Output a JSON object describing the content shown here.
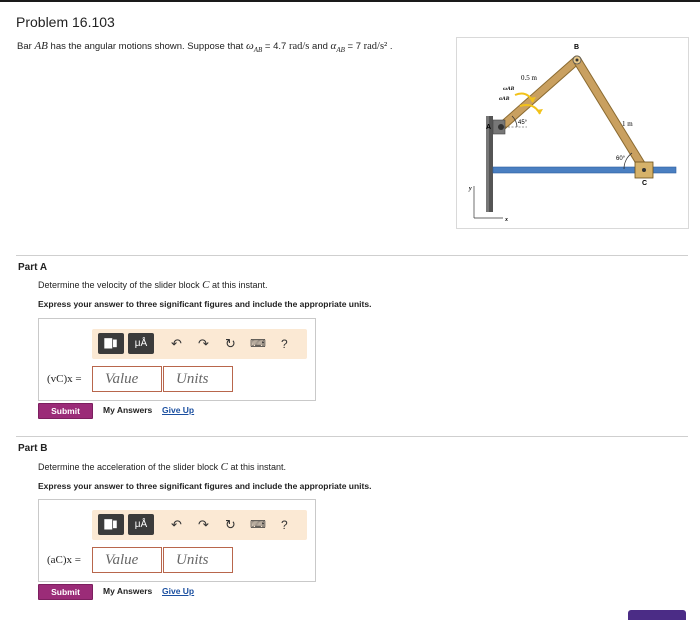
{
  "problem": {
    "title": "Problem 16.103",
    "statement_prefix": "Bar",
    "statement_bar": "AB",
    "statement_mid": "has the angular motions shown. Suppose that",
    "omega_sym": "ω",
    "omega_sub": "AB",
    "omega_eq": " = 4.7 ",
    "omega_unit": "rad/s",
    "and_text": " and ",
    "alpha_sym": "α",
    "alpha_sub": "AB",
    "alpha_eq": " = 7 ",
    "alpha_unit": "rad/s²",
    "period": " ."
  },
  "figure": {
    "label_B": "B",
    "label_A": "A",
    "label_C": "C",
    "label_len_ab": "0.5 m",
    "label_len_bc": "1 m",
    "label_omega": "ωAB",
    "label_alpha": "αAB",
    "label_angle_a": "45°",
    "label_angle_c": "60°",
    "label_axis_y": "y",
    "label_axis_x": "x"
  },
  "parts": [
    {
      "title": "Part A",
      "question_prefix": "Determine the velocity of the slider block",
      "question_var": "C",
      "question_suffix": "at this instant.",
      "instruction": "Express your answer to three significant figures and include the appropriate units.",
      "lhs_label": "(vC)x =",
      "value_placeholder": "Value",
      "units_placeholder": "Units",
      "submit_label": "Submit",
      "my_answers_label": "My Answers",
      "give_up_label": "Give Up"
    },
    {
      "title": "Part B",
      "question_prefix": "Determine the acceleration of the slider block",
      "question_var": "C",
      "question_suffix": "at this instant.",
      "instruction": "Express your answer to three significant figures and include the appropriate units.",
      "lhs_label": "(aC)x =",
      "value_placeholder": "Value",
      "units_placeholder": "Units",
      "submit_label": "Submit",
      "my_answers_label": "My Answers",
      "give_up_label": "Give Up"
    }
  ],
  "toolbar": {
    "templates_icon": "templates-icon",
    "units_label": "μÅ",
    "undo_icon": "undo-icon",
    "redo_icon": "redo-icon",
    "reset_icon": "reset-icon",
    "keyboard_icon": "keyboard-icon",
    "help_label": "?"
  },
  "colors": {
    "submit_bg": "#9b2c78",
    "toolbar_bg": "#fbe9d4",
    "field_border": "#b8664c",
    "link": "#1a4fa0",
    "bar_color": "#c9a060",
    "slider_rail": "#4a7fc1"
  }
}
